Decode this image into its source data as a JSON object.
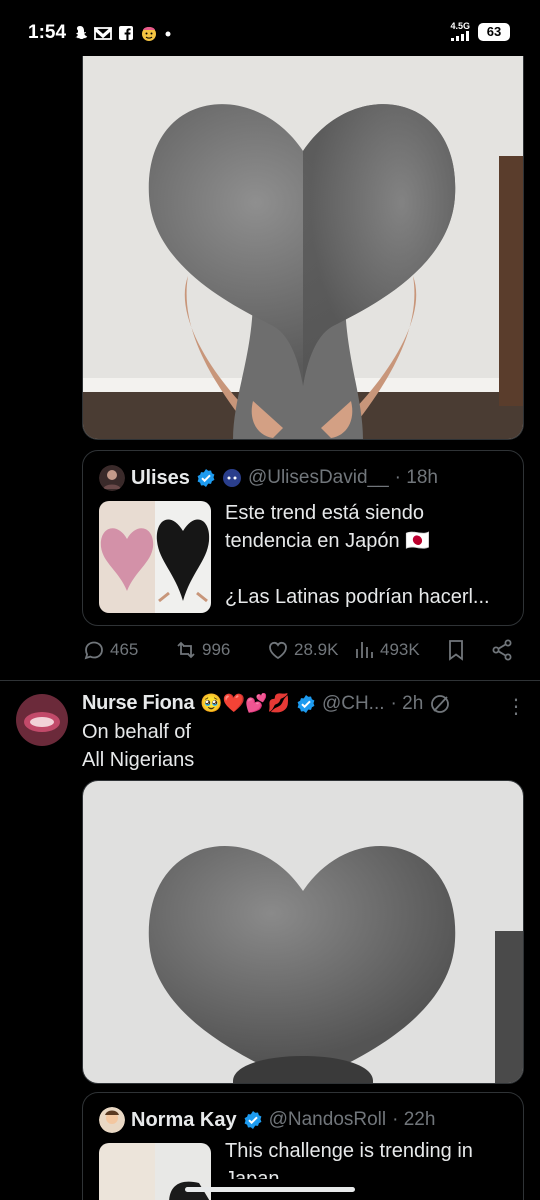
{
  "status_bar": {
    "time": "1:54",
    "network": "4.5G",
    "battery": "63",
    "notification_icons": [
      "snapchat-icon",
      "mail-icon",
      "facebook-icon",
      "emoji-icon",
      "dot-icon"
    ]
  },
  "tweet1": {
    "quote": {
      "name": "Ulises",
      "handle": "@UlisesDavid__",
      "time": "· 18h",
      "text_line1": "Este trend está siendo",
      "text_line2": "tendencia en Japón 🇯🇵",
      "text_line3": "¿Las Latinas podrían hacerl..."
    },
    "actions": {
      "replies": "465",
      "reposts": "996",
      "likes": "28.9K",
      "views": "493K"
    }
  },
  "tweet2": {
    "name": "Nurse Fiona",
    "name_emojis": "🥹❤️💕💋",
    "handle": "@CH...",
    "time": "· 2h",
    "text_line1": "On behalf of",
    "text_line2": "All Nigerians",
    "quote": {
      "name": "Norma Kay",
      "handle": "@NandosRoll",
      "time": "· 22h",
      "text_line1": "This challenge is trending in",
      "text_line2": "Japan"
    }
  },
  "colors": {
    "background": "#000000",
    "text": "#e7e9ea",
    "muted": "#71767b",
    "border": "#2f3336",
    "verified": "#1d9bf0"
  }
}
